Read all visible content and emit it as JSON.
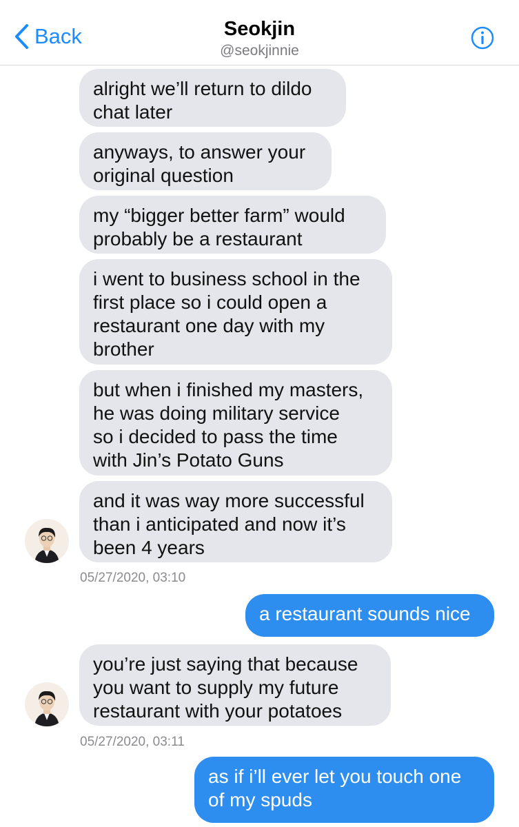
{
  "header": {
    "back_label": "Back",
    "name": "Seokjin",
    "handle": "@seokjinnie"
  },
  "messages": [
    {
      "side": "in",
      "text": "alright we’ll return to dildo\nchat later"
    },
    {
      "side": "in",
      "text": "anyways, to answer your\noriginal question"
    },
    {
      "side": "in",
      "text": "my “bigger better farm” would\nprobably be a restaurant"
    },
    {
      "side": "in",
      "text": "i went to business school in the\nfirst place so i could open a\nrestaurant one day with my\nbrother"
    },
    {
      "side": "in",
      "text": "but when i finished my masters,\nhe was doing military service\nso i decided to pass the time\nwith Jin’s Potato Guns"
    },
    {
      "side": "in",
      "text": "and it was way more successful\nthan i anticipated and now it’s\nbeen 4 years"
    },
    {
      "side": "out",
      "text": "a restaurant sounds nice"
    },
    {
      "side": "in",
      "text": "you’re just saying that because\nyou want to supply my future\nrestaurant with your potatoes"
    },
    {
      "side": "out",
      "text": "as if i’ll ever let you touch one\nof my spuds"
    }
  ],
  "timestamps": [
    "05/27/2020, 03:10",
    "05/27/2020, 03:11"
  ],
  "colors": {
    "accent": "#1a8cff",
    "incoming_bubble": "#e5e6eb",
    "outgoing_bubble": "#2e8ef0"
  },
  "icons": [
    "chevron-left-icon",
    "info-icon",
    "avatar"
  ]
}
